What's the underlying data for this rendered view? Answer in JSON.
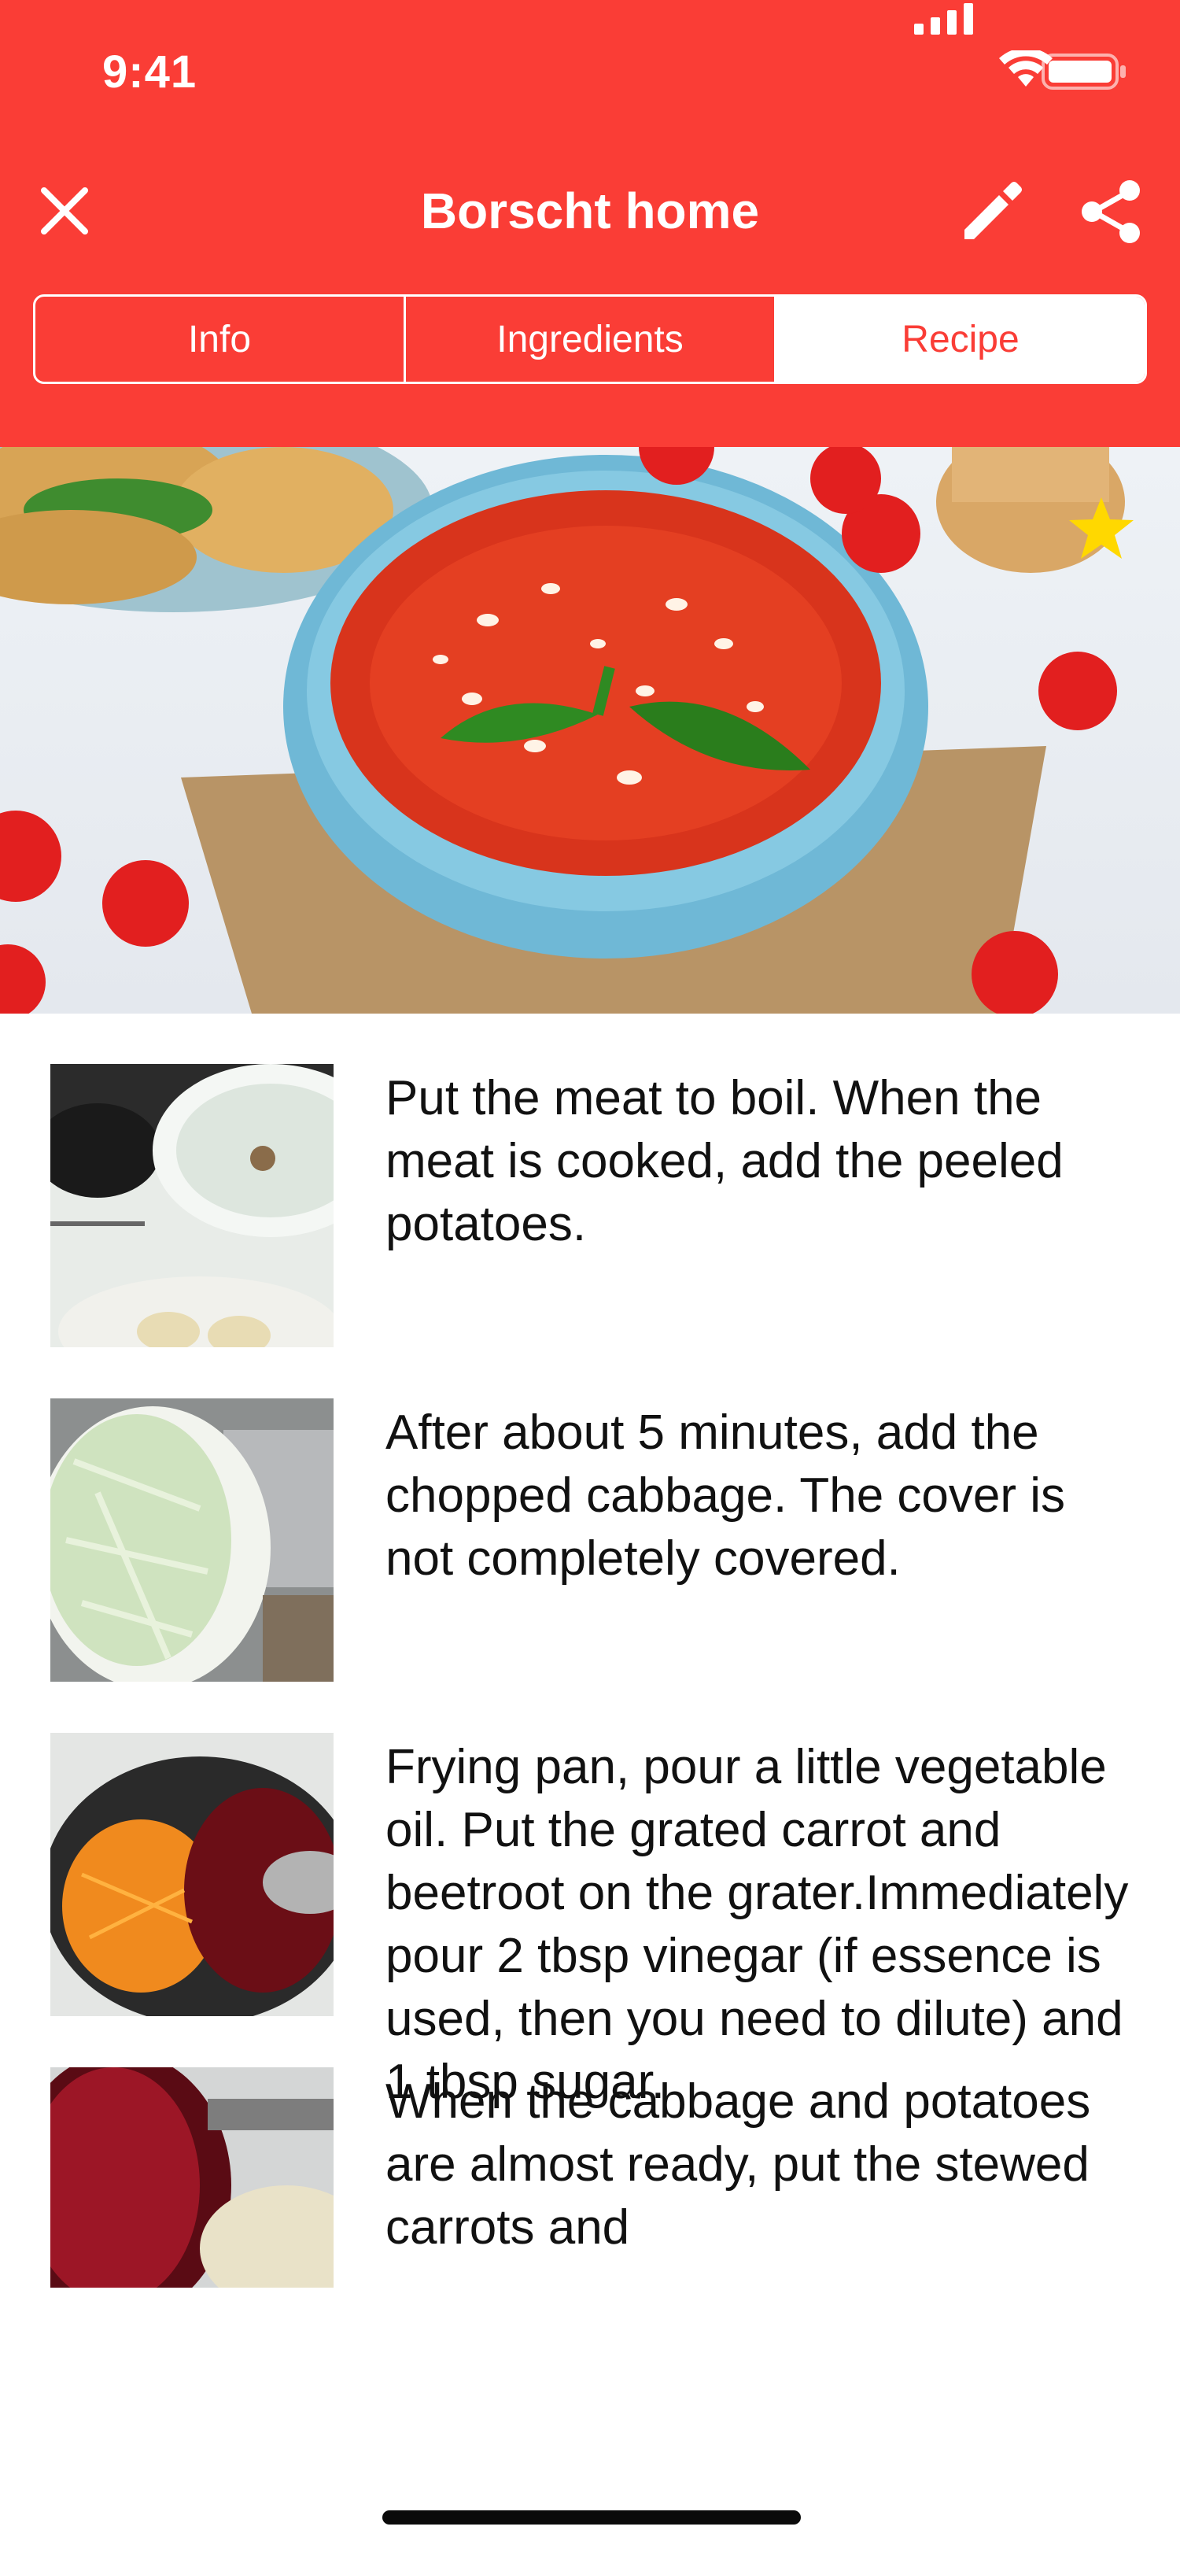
{
  "status_bar": {
    "time": "9:41"
  },
  "nav": {
    "title": "Borscht home",
    "close_icon": "close-icon",
    "edit_icon": "pencil-icon",
    "share_icon": "share-icon"
  },
  "tabs": [
    {
      "label": "Info",
      "active": false
    },
    {
      "label": "Ingredients",
      "active": false
    },
    {
      "label": "Recipe",
      "active": true
    }
  ],
  "hero": {
    "favorite_icon": "star-icon",
    "favorited": true
  },
  "steps": [
    {
      "text": "Put the meat to boil. When the meat is cooked, add the peeled potatoes."
    },
    {
      "text": "After about 5 minutes, add the chopped cabbage. The cover is not completely covered."
    },
    {
      "text": "Frying pan, pour a little vegetable oil. Put the grated carrot and beetroot on the grater.Immediately pour 2 tbsp vinegar (if essence is used, then you need to dilute) and 1 tbsp sugar."
    },
    {
      "text": "When the cabbage and potatoes are almost ready, put the stewed carrots and"
    }
  ],
  "colors": {
    "accent": "#fa3d36",
    "star": "#ffd800"
  }
}
